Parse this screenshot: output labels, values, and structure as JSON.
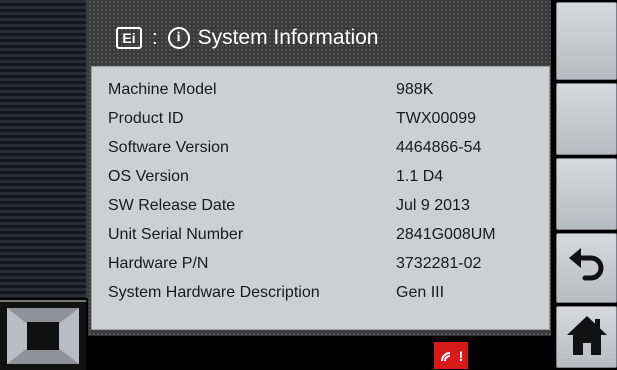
{
  "header": {
    "icon_text": "Ei",
    "separator": ":",
    "info_icon_text": "i",
    "title": "System Information"
  },
  "info": [
    {
      "label": "Machine Model",
      "value": "988K"
    },
    {
      "label": "Product ID",
      "value": "TWX00099"
    },
    {
      "label": "Software Version",
      "value": "4464866-54"
    },
    {
      "label": "OS Version",
      "value": "1.1 D4"
    },
    {
      "label": "SW Release Date",
      "value": "Jul  9 2013"
    },
    {
      "label": "Unit Serial Number",
      "value": "2841G008UM"
    },
    {
      "label": "Hardware P/N",
      "value": "3732281-02"
    },
    {
      "label": "System Hardware Description",
      "value": "Gen III"
    }
  ],
  "status": {
    "alert_text": "!",
    "alert_color": "#d61a1a"
  },
  "right_buttons": [
    {
      "icon": "blank"
    },
    {
      "icon": "blank"
    },
    {
      "icon": "blank"
    },
    {
      "icon": "back-arrow-icon"
    },
    {
      "icon": "home-icon"
    }
  ]
}
